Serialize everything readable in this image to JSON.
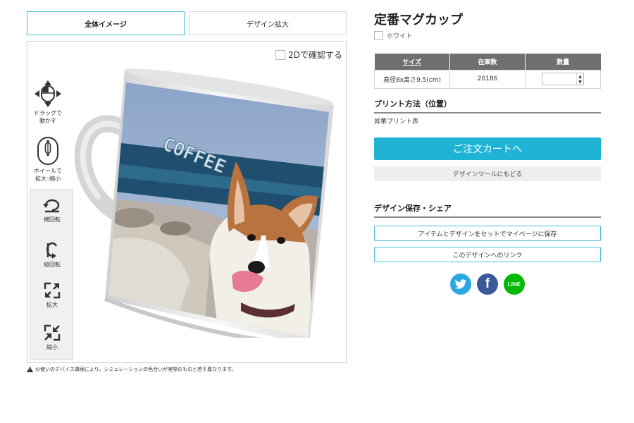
{
  "tabs": {
    "overview": "全体イメージ",
    "zoom": "デザイン拡大"
  },
  "preview": {
    "check_2d_label": "2Dで確認する",
    "drag_label_1": "ドラッグで",
    "drag_label_2": "動かす",
    "wheel_label_1": "ホイールで",
    "wheel_label_2": "拡大･縮小",
    "rotate_horizontal": "横回転",
    "rotate_vertical": "縦回転",
    "zoom_in": "拡大",
    "zoom_out": "縮小",
    "mug_print_text": "COFFEE"
  },
  "disclaimer": "お使いのデバイス環境により、シミュレーションの色合いが実際のものと若干異なります。",
  "product": {
    "title": "定番マグカップ",
    "color_option": "ホワイト"
  },
  "stock_table": {
    "headers": {
      "size": "サイズ",
      "stock": "在庫数",
      "quantity": "数量"
    },
    "row": {
      "size": "直径8x高さ9.5(cm)",
      "stock": "20186",
      "quantity": ""
    }
  },
  "print": {
    "heading": "プリント方法（位置）",
    "method": "昇華プリント表"
  },
  "buttons": {
    "cart": "ご注文カートへ",
    "back_to_tool": "デザインツールにもどる",
    "save_to_mypage": "アイテムとデザインをセットでマイページに保存",
    "design_link": "このデザインへのリンク"
  },
  "save_share": {
    "heading": "デザイン保存・シェア"
  },
  "share": {
    "facebook_glyph": "f",
    "line_label": "LINE"
  },
  "colors": {
    "accent": "#1fb4d6",
    "outline": "#4bbfd3",
    "table_header": "#6f6f6f",
    "twitter": "#2aa9e0",
    "facebook": "#3b5998",
    "line": "#00b900"
  }
}
